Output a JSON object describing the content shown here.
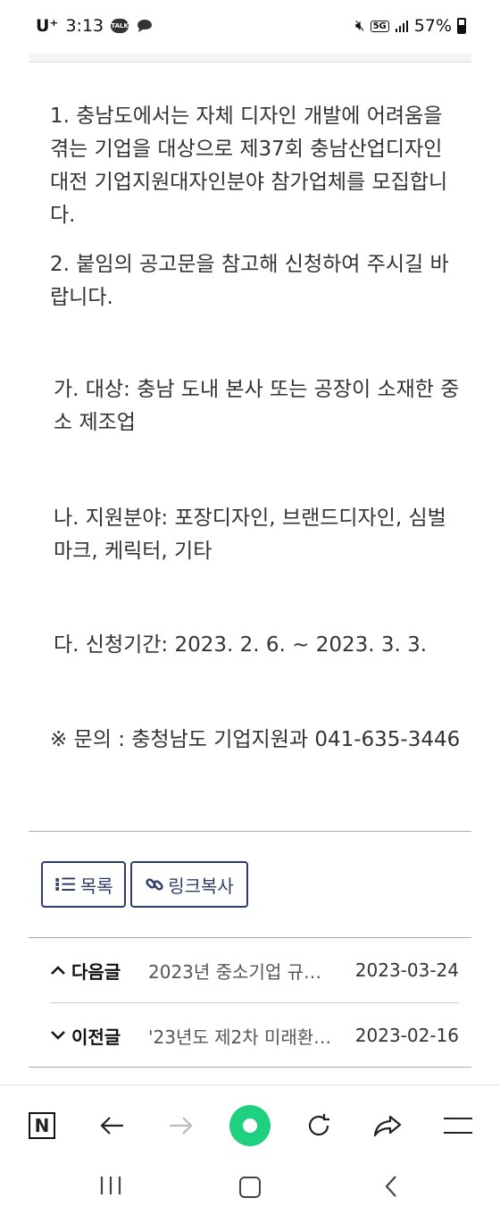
{
  "status_bar": {
    "carrier": "U⁺",
    "time": "3:13",
    "talk_badge": "TALK",
    "network": "5G",
    "battery": "57%"
  },
  "notice": {
    "paragraphs": [
      "1. 충남도에서는 자체 디자인 개발에 어려움을 겪는 기업을 대상으로 제37회 충남산업디자인대전 기업지원대자인분야 참가업체를 모집합니다.",
      "2. 붙임의 공고문을 참고해 신청하여 주시길 바랍니다.",
      "가. 대상: 충남 도내 본사 또는 공장이 소재한 중소 제조업",
      "나. 지원분야: 포장디자인, 브랜드디자인, 심벌마크, 케릭터, 기타",
      "다. 신청기간: 2023. 2. 6. ~ 2023. 3. 3.",
      "※ 문의 : 충청남도 기업지원과 041-635-3446"
    ]
  },
  "actions": {
    "list_label": "목록",
    "copy_link_label": "링크복사"
  },
  "post_nav": {
    "next": {
      "label": "다음글",
      "title": "2023년 중소기업 규…",
      "date": "2023-03-24"
    },
    "prev": {
      "label": "이전글",
      "title": "'23년도 제2차 미래환…",
      "date": "2023-02-16"
    }
  },
  "browser_bar": {
    "icons": [
      "naver-home-icon",
      "back-icon",
      "forward-icon",
      "green-dot-icon",
      "refresh-icon",
      "share-icon",
      "menu-icon"
    ]
  },
  "system_nav": {
    "icons": [
      "recents-icon",
      "home-icon",
      "back-icon"
    ]
  }
}
